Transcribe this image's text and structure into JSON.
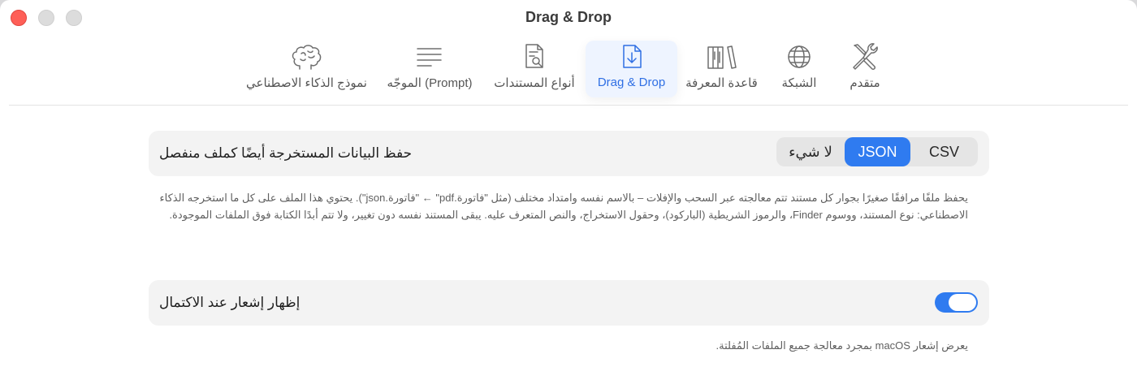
{
  "window": {
    "title": "Drag & Drop"
  },
  "tabs": [
    {
      "label": "نموذج الذكاء الاصطناعي",
      "icon": "brain-icon",
      "active": false
    },
    {
      "label": "الموجّه (Prompt)",
      "icon": "lines-icon",
      "active": false
    },
    {
      "label": "أنواع المستندات",
      "icon": "document-search-icon",
      "active": false
    },
    {
      "label": "Drag & Drop",
      "icon": "document-download-icon",
      "active": true
    },
    {
      "label": "قاعدة المعرفة",
      "icon": "books-icon",
      "active": false
    },
    {
      "label": "الشبكة",
      "icon": "globe-icon",
      "active": false
    },
    {
      "label": "متقدم",
      "icon": "tools-icon",
      "active": false
    }
  ],
  "export_setting": {
    "label": "حفظ البيانات المستخرجة أيضًا كملف منفصل",
    "options": [
      "لا شيء",
      "JSON",
      "CSV"
    ],
    "selected": "JSON",
    "description": "يحفظ ملفًا مرافقًا صغيرًا بجوار كل مستند تتم معالجته عبر السحب والإفلات – بالاسم نفسه وامتداد مختلف (مثل \"فاتورة.pdf\" ← \"فاتورة.json\"). يحتوي هذا الملف على كل ما استخرجه الذكاء الاصطناعي: نوع المستند، ووسوم Finder، والرموز الشريطية (الباركود)، وحقول الاستخراج، والنص المتعرف عليه. يبقى المستند نفسه دون تغيير، ولا تتم أبدًا الكتابة فوق الملفات الموجودة."
  },
  "notification_setting": {
    "label": "إظهار إشعار عند الاكتمال",
    "enabled": true,
    "description": "يعرض إشعار macOS بمجرد معالجة جميع الملفات المُفلتة."
  },
  "colors": {
    "accent": "#2f7bf0",
    "close": "#fe5f57",
    "row_bg": "#f3f3f3"
  }
}
